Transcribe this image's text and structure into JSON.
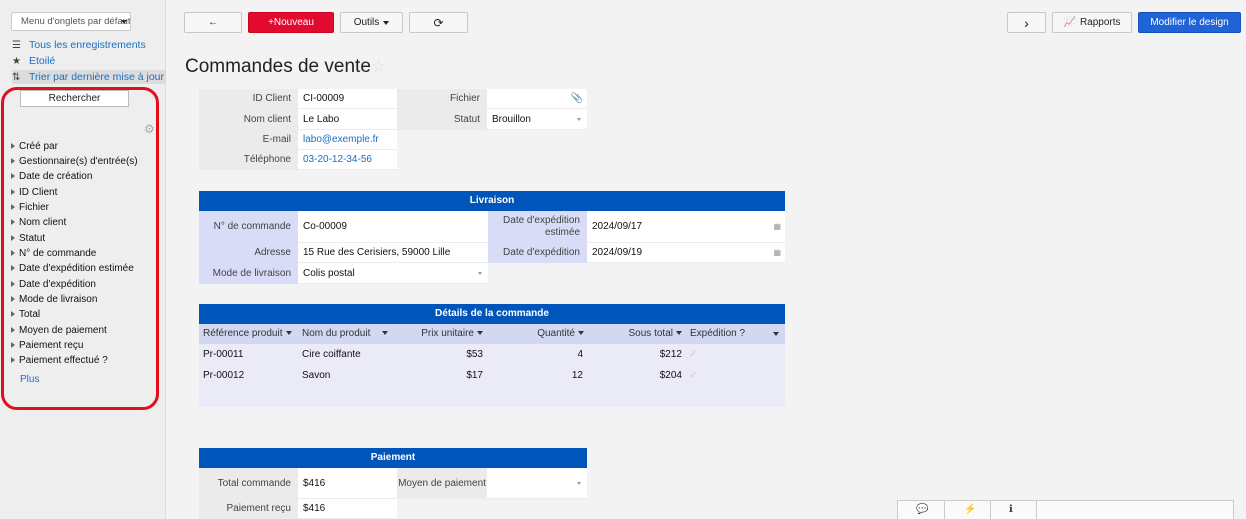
{
  "sidebar": {
    "tab_menu": "Menu d'onglets par défaut",
    "nav": [
      {
        "label": "Tous les enregistrements",
        "icon": "list-icon"
      },
      {
        "label": "Etoilé",
        "icon": "star-icon"
      },
      {
        "label": "Trier par dernière mise à jour",
        "icon": "sort-icon"
      }
    ],
    "search_label": "Rechercher",
    "filters": [
      "Créé par",
      "Gestionnaire(s) d'entrée(s)",
      "Date de création",
      "ID Client",
      "Fichier",
      "Nom client",
      "Statut",
      "N° de commande",
      "Date d'expédition estimée",
      "Date d'expédition",
      "Mode de livraison",
      "Total",
      "Moyen de paiement",
      "Paiement reçu",
      "Paiement effectué ?"
    ],
    "more_label": "Plus"
  },
  "toolbar": {
    "back": "←",
    "new_label": "+Nouveau",
    "tools_label": "Outils",
    "refresh": "⟳",
    "next": "›",
    "reports_label": "Rapports",
    "design_label": "Modifier le design"
  },
  "page_title": "Commandes de vente",
  "client": {
    "id_label": "ID Client",
    "id_value": "CI-00009",
    "name_label": "Nom client",
    "name_value": "Le Labo",
    "email_label": "E-mail",
    "email_value": "labo@exemple.fr",
    "phone_label": "Téléphone",
    "phone_value": "03-20-12-34-56",
    "file_label": "Fichier",
    "file_value": "",
    "status_label": "Statut",
    "status_value": "Brouillon"
  },
  "delivery": {
    "heading": "Livraison",
    "order_no_label": "N° de commande",
    "order_no_value": "Co-00009",
    "address_label": "Adresse",
    "address_value": "15 Rue des Cerisiers, 59000 Lille",
    "mode_label": "Mode de livraison",
    "mode_value": "Colis postal",
    "est_date_label": "Date d'expédition estimée",
    "est_date_value": "2024/09/17",
    "ship_date_label": "Date d'expédition",
    "ship_date_value": "2024/09/19"
  },
  "details": {
    "heading": "Détails de la commande",
    "columns": [
      "Référence produit",
      "Nom du produit",
      "Prix unitaire",
      "Quantité",
      "Sous total",
      "Expédition ?"
    ],
    "rows": [
      {
        "ref": "Pr-00011",
        "name": "Cire coiffante",
        "price": "$53",
        "qty": "4",
        "subtotal": "$212"
      },
      {
        "ref": "Pr-00012",
        "name": "Savon",
        "price": "$17",
        "qty": "12",
        "subtotal": "$204"
      }
    ]
  },
  "payment": {
    "heading": "Paiement",
    "total_label": "Total commande",
    "total_value": "$416",
    "method_label": "Moyen de paiement",
    "method_value": "",
    "received_label": "Paiement reçu",
    "received_value": "$416"
  },
  "colors": {
    "accent_red": "#e20a2f",
    "accent_blue": "#1f63d6",
    "section_blue": "#0055bb",
    "highlight_ring": "#e0101a"
  }
}
